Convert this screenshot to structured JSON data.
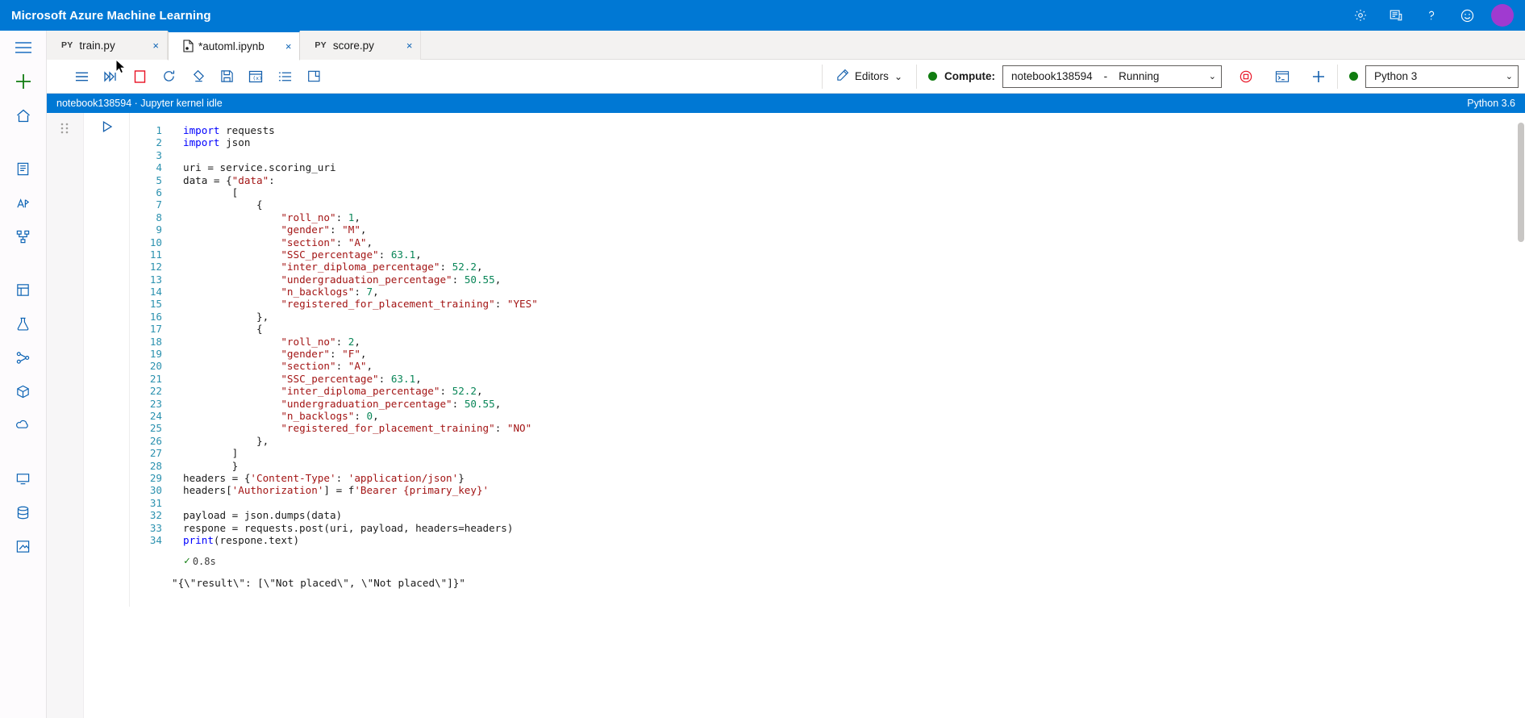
{
  "window": {
    "brand_title": "Microsoft Azure Machine Learning",
    "avatar_initials": ""
  },
  "topbar_icons": [
    {
      "name": "settings-gear-icon",
      "label": "Settings"
    },
    {
      "name": "feedback-icon",
      "label": "Feedback"
    },
    {
      "name": "help-icon",
      "label": "Help"
    },
    {
      "name": "smiley-icon",
      "label": "Send a smile"
    }
  ],
  "left_rail": [
    {
      "name": "hamburger-menu-icon",
      "label": "Menu"
    },
    {
      "name": "new-plus-icon",
      "label": "New"
    },
    {
      "name": "home-icon",
      "label": "Home"
    },
    {
      "name": "notebooks-icon",
      "label": "Notebooks"
    },
    {
      "name": "automated-ml-icon",
      "label": "Automated ML"
    },
    {
      "name": "designer-icon",
      "label": "Designer"
    },
    {
      "name": "datasets-icon",
      "label": "Datasets"
    },
    {
      "name": "experiments-icon",
      "label": "Experiments"
    },
    {
      "name": "pipelines-icon",
      "label": "Pipelines"
    },
    {
      "name": "models-icon",
      "label": "Models"
    },
    {
      "name": "endpoints-icon",
      "label": "Endpoints"
    },
    {
      "name": "compute-icon",
      "label": "Compute"
    },
    {
      "name": "datastores-icon",
      "label": "Datastores"
    },
    {
      "name": "labeling-icon",
      "label": "Data labeling"
    }
  ],
  "tabs": [
    {
      "kind": "PY",
      "label": "train.py",
      "active": false,
      "modified": false,
      "close": "×"
    },
    {
      "kind": "",
      "label": "*automl.ipynb",
      "active": true,
      "modified": true,
      "close": "×"
    },
    {
      "kind": "PY",
      "label": "score.py",
      "active": false,
      "modified": false,
      "close": "×"
    }
  ],
  "toolbar": {
    "icons": [
      {
        "name": "run-all-menu-icon",
        "label": "Notebook menu"
      },
      {
        "name": "run-all-cells-icon",
        "label": "Run all cells"
      },
      {
        "name": "insert-cell-icon",
        "label": "Insert cell"
      },
      {
        "name": "restart-kernel-icon",
        "label": "Restart kernel"
      },
      {
        "name": "clear-output-icon",
        "label": "Clear output"
      },
      {
        "name": "save-icon",
        "label": "Save"
      },
      {
        "name": "variable-explorer-icon",
        "label": "Variable explorer"
      },
      {
        "name": "outline-icon",
        "label": "Table of contents"
      },
      {
        "name": "focus-mode-icon",
        "label": "Focus mode"
      }
    ],
    "editors_label": "Editors",
    "editors_caret": "⌄",
    "compute_label": "Compute:",
    "compute_name": "notebook138594",
    "compute_separator": "-",
    "compute_status": "Running",
    "compute_caret": "⌄",
    "stop_compute_label": "Stop compute",
    "terminal_label": "Open terminal",
    "new_compute_label": "New compute",
    "kernel_name": "Python 3",
    "kernel_caret": "⌄"
  },
  "kernel_bar": {
    "left_text": "notebook138594 · Jupyter kernel idle",
    "right_text": "Python 3.6"
  },
  "notebook": {
    "drag_handle": "⋮⋮",
    "run_cell_label": "Run cell",
    "execution_time": "0.8s",
    "execution_check": "✓",
    "output_text": "\"{\\\"result\\\": [\\\"Not placed\\\", \\\"Not placed\\\"]}\"",
    "code_lines": [
      {
        "n": "1",
        "tokens": [
          {
            "t": "import",
            "c": "kw"
          },
          {
            "t": " requests",
            "c": "pl"
          }
        ]
      },
      {
        "n": "2",
        "tokens": [
          {
            "t": "import",
            "c": "kw"
          },
          {
            "t": " json",
            "c": "pl"
          }
        ]
      },
      {
        "n": "3",
        "tokens": [
          {
            "t": "",
            "c": "pl"
          }
        ]
      },
      {
        "n": "4",
        "tokens": [
          {
            "t": "uri = service.scoring_uri",
            "c": "pl"
          }
        ]
      },
      {
        "n": "5",
        "tokens": [
          {
            "t": "data = {",
            "c": "pl"
          },
          {
            "t": "\"data\"",
            "c": "str"
          },
          {
            "t": ":",
            "c": "pl"
          }
        ]
      },
      {
        "n": "6",
        "tokens": [
          {
            "t": "        [",
            "c": "pl"
          }
        ]
      },
      {
        "n": "7",
        "tokens": [
          {
            "t": "            {",
            "c": "pl"
          }
        ]
      },
      {
        "n": "8",
        "tokens": [
          {
            "t": "                ",
            "c": "pl"
          },
          {
            "t": "\"roll_no\"",
            "c": "str"
          },
          {
            "t": ": ",
            "c": "pl"
          },
          {
            "t": "1",
            "c": "num"
          },
          {
            "t": ",",
            "c": "pl"
          }
        ]
      },
      {
        "n": "9",
        "tokens": [
          {
            "t": "                ",
            "c": "pl"
          },
          {
            "t": "\"gender\"",
            "c": "str"
          },
          {
            "t": ": ",
            "c": "pl"
          },
          {
            "t": "\"M\"",
            "c": "str"
          },
          {
            "t": ",",
            "c": "pl"
          }
        ]
      },
      {
        "n": "10",
        "tokens": [
          {
            "t": "                ",
            "c": "pl"
          },
          {
            "t": "\"section\"",
            "c": "str"
          },
          {
            "t": ": ",
            "c": "pl"
          },
          {
            "t": "\"A\"",
            "c": "str"
          },
          {
            "t": ",",
            "c": "pl"
          }
        ]
      },
      {
        "n": "11",
        "tokens": [
          {
            "t": "                ",
            "c": "pl"
          },
          {
            "t": "\"SSC_percentage\"",
            "c": "str"
          },
          {
            "t": ": ",
            "c": "pl"
          },
          {
            "t": "63.1",
            "c": "num"
          },
          {
            "t": ",",
            "c": "pl"
          }
        ]
      },
      {
        "n": "12",
        "tokens": [
          {
            "t": "                ",
            "c": "pl"
          },
          {
            "t": "\"inter_diploma_percentage\"",
            "c": "str"
          },
          {
            "t": ": ",
            "c": "pl"
          },
          {
            "t": "52.2",
            "c": "num"
          },
          {
            "t": ",",
            "c": "pl"
          }
        ]
      },
      {
        "n": "13",
        "tokens": [
          {
            "t": "                ",
            "c": "pl"
          },
          {
            "t": "\"undergraduation_percentage\"",
            "c": "str"
          },
          {
            "t": ": ",
            "c": "pl"
          },
          {
            "t": "50.55",
            "c": "num"
          },
          {
            "t": ",",
            "c": "pl"
          }
        ]
      },
      {
        "n": "14",
        "tokens": [
          {
            "t": "                ",
            "c": "pl"
          },
          {
            "t": "\"n_backlogs\"",
            "c": "str"
          },
          {
            "t": ": ",
            "c": "pl"
          },
          {
            "t": "7",
            "c": "num"
          },
          {
            "t": ",",
            "c": "pl"
          }
        ]
      },
      {
        "n": "15",
        "tokens": [
          {
            "t": "                ",
            "c": "pl"
          },
          {
            "t": "\"registered_for_placement_training\"",
            "c": "str"
          },
          {
            "t": ": ",
            "c": "pl"
          },
          {
            "t": "\"YES\"",
            "c": "str"
          }
        ]
      },
      {
        "n": "16",
        "tokens": [
          {
            "t": "            },",
            "c": "pl"
          }
        ]
      },
      {
        "n": "17",
        "tokens": [
          {
            "t": "            {",
            "c": "pl"
          }
        ]
      },
      {
        "n": "18",
        "tokens": [
          {
            "t": "                ",
            "c": "pl"
          },
          {
            "t": "\"roll_no\"",
            "c": "str"
          },
          {
            "t": ": ",
            "c": "pl"
          },
          {
            "t": "2",
            "c": "num"
          },
          {
            "t": ",",
            "c": "pl"
          }
        ]
      },
      {
        "n": "19",
        "tokens": [
          {
            "t": "                ",
            "c": "pl"
          },
          {
            "t": "\"gender\"",
            "c": "str"
          },
          {
            "t": ": ",
            "c": "pl"
          },
          {
            "t": "\"F\"",
            "c": "str"
          },
          {
            "t": ",",
            "c": "pl"
          }
        ]
      },
      {
        "n": "20",
        "tokens": [
          {
            "t": "                ",
            "c": "pl"
          },
          {
            "t": "\"section\"",
            "c": "str"
          },
          {
            "t": ": ",
            "c": "pl"
          },
          {
            "t": "\"A\"",
            "c": "str"
          },
          {
            "t": ",",
            "c": "pl"
          }
        ]
      },
      {
        "n": "21",
        "tokens": [
          {
            "t": "                ",
            "c": "pl"
          },
          {
            "t": "\"SSC_percentage\"",
            "c": "str"
          },
          {
            "t": ": ",
            "c": "pl"
          },
          {
            "t": "63.1",
            "c": "num"
          },
          {
            "t": ",",
            "c": "pl"
          }
        ]
      },
      {
        "n": "22",
        "tokens": [
          {
            "t": "                ",
            "c": "pl"
          },
          {
            "t": "\"inter_diploma_percentage\"",
            "c": "str"
          },
          {
            "t": ": ",
            "c": "pl"
          },
          {
            "t": "52.2",
            "c": "num"
          },
          {
            "t": ",",
            "c": "pl"
          }
        ]
      },
      {
        "n": "23",
        "tokens": [
          {
            "t": "                ",
            "c": "pl"
          },
          {
            "t": "\"undergraduation_percentage\"",
            "c": "str"
          },
          {
            "t": ": ",
            "c": "pl"
          },
          {
            "t": "50.55",
            "c": "num"
          },
          {
            "t": ",",
            "c": "pl"
          }
        ]
      },
      {
        "n": "24",
        "tokens": [
          {
            "t": "                ",
            "c": "pl"
          },
          {
            "t": "\"n_backlogs\"",
            "c": "str"
          },
          {
            "t": ": ",
            "c": "pl"
          },
          {
            "t": "0",
            "c": "num"
          },
          {
            "t": ",",
            "c": "pl"
          }
        ]
      },
      {
        "n": "25",
        "tokens": [
          {
            "t": "                ",
            "c": "pl"
          },
          {
            "t": "\"registered_for_placement_training\"",
            "c": "str"
          },
          {
            "t": ": ",
            "c": "pl"
          },
          {
            "t": "\"NO\"",
            "c": "str"
          }
        ]
      },
      {
        "n": "26",
        "tokens": [
          {
            "t": "            },",
            "c": "pl"
          }
        ]
      },
      {
        "n": "27",
        "tokens": [
          {
            "t": "        ]",
            "c": "pl"
          }
        ]
      },
      {
        "n": "28",
        "tokens": [
          {
            "t": "        }",
            "c": "pl"
          }
        ]
      },
      {
        "n": "29",
        "tokens": [
          {
            "t": "headers = {",
            "c": "pl"
          },
          {
            "t": "'Content-Type'",
            "c": "str"
          },
          {
            "t": ": ",
            "c": "pl"
          },
          {
            "t": "'application/json'",
            "c": "str"
          },
          {
            "t": "}",
            "c": "pl"
          }
        ]
      },
      {
        "n": "30",
        "tokens": [
          {
            "t": "headers[",
            "c": "pl"
          },
          {
            "t": "'Authorization'",
            "c": "str"
          },
          {
            "t": "] = f",
            "c": "pl"
          },
          {
            "t": "'Bearer {primary_key}'",
            "c": "str"
          }
        ]
      },
      {
        "n": "31",
        "tokens": [
          {
            "t": "",
            "c": "pl"
          }
        ]
      },
      {
        "n": "32",
        "tokens": [
          {
            "t": "payload = json.dumps(data)",
            "c": "pl"
          }
        ]
      },
      {
        "n": "33",
        "tokens": [
          {
            "t": "respone = requests.post(uri, payload, headers=headers)",
            "c": "pl"
          }
        ]
      },
      {
        "n": "34",
        "tokens": [
          {
            "t": "print",
            "c": "fn"
          },
          {
            "t": "(respone.text)",
            "c": "pl"
          }
        ]
      }
    ]
  },
  "colors": {
    "brand_blue": "#0078d4",
    "accent_green": "#107c10",
    "stop_red": "#d13438",
    "keyword_blue": "#0000ff",
    "string_red": "#a31515",
    "number_green": "#098658",
    "linenum_teal": "#2b91af"
  }
}
